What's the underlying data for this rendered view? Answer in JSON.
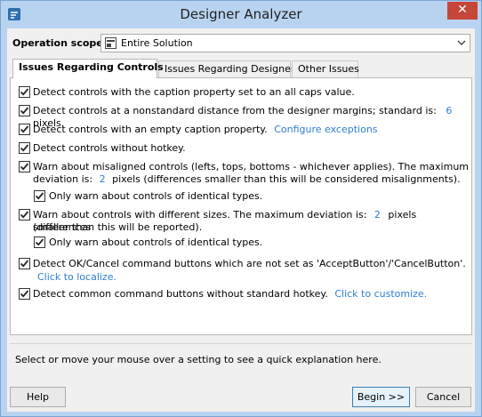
{
  "window": {
    "title": "Designer Analyzer"
  },
  "scope": {
    "label": "Operation scope:",
    "value": "Entire Solution"
  },
  "tabs": [
    {
      "label": "Issues Regarding Controls"
    },
    {
      "label": "Issues Regarding Designers"
    },
    {
      "label": "Other Issues"
    }
  ],
  "settings": {
    "caps_caption": {
      "text": "Detect controls with the caption property set to an all caps value.",
      "checked": true
    },
    "nonstandard_distance": {
      "text_before": "Detect controls at a nonstandard distance from the designer margins; standard is:",
      "value": "6",
      "unit": "pixels.",
      "checked": true
    },
    "empty_caption": {
      "text": "Detect controls with an empty caption property.",
      "link": "Configure exceptions",
      "checked": true
    },
    "no_hotkey": {
      "text": "Detect controls without hotkey.",
      "checked": true
    },
    "misaligned": {
      "line1": "Warn about misaligned controls (lefts, tops, bottoms - whichever applies). The maximum",
      "line2_before": "deviation is:",
      "value": "2",
      "line2_after": "pixels (differences smaller than this will be considered misalignments).",
      "checked": true
    },
    "misaligned_identical": {
      "text": "Only warn about controls of identical types.",
      "checked": true
    },
    "diff_sizes": {
      "line1_before": "Warn about controls with different sizes. The maximum deviation is:",
      "value": "2",
      "line1_after": "pixels (differences",
      "line2": "smaller than this will be reported).",
      "checked": true
    },
    "sizes_identical": {
      "text": "Only warn about controls of identical types.",
      "checked": true
    },
    "ok_cancel": {
      "text": "Detect OK/Cancel command buttons which are not set as 'AcceptButton'/'CancelButton'.",
      "link": "Click to localize.",
      "checked": true
    },
    "common_hotkey": {
      "text": "Detect common command buttons without standard hotkey.",
      "link": "Click to customize.",
      "checked": true
    }
  },
  "info": {
    "text": "Select or move your mouse over a setting to see a quick explanation here."
  },
  "buttons": {
    "help": "Help",
    "begin": "Begin >>",
    "cancel": "Cancel"
  },
  "colors": {
    "link": "#2f7dd1",
    "titlebar": "#b8d3f0",
    "close": "#c7463a"
  },
  "icons": {
    "app": "app-icon",
    "close": "close-icon",
    "scope": "solution-icon",
    "dropdown": "chevron-down-icon",
    "check": "check-icon"
  }
}
